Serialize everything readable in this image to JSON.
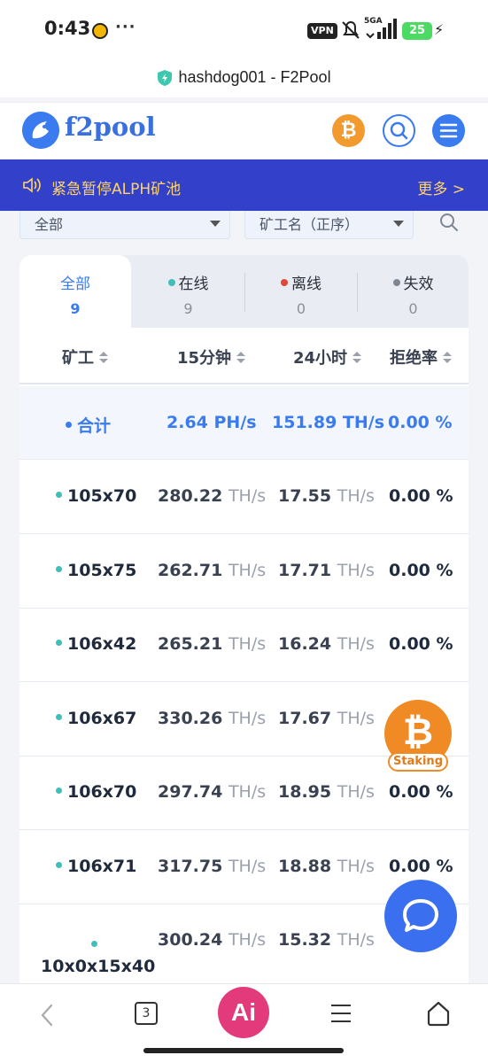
{
  "status_bar": {
    "time": "0:43",
    "dots": "···",
    "vpn": "VPN",
    "network": "5GA",
    "battery": "25"
  },
  "browser": {
    "page_title": "hashdog001 - F2Pool",
    "tab_count": "3",
    "ai_label": "Ai"
  },
  "site": {
    "logo_text": "f2pool",
    "btc_symbol": "₿"
  },
  "announcement": {
    "text": "紧急暂停ALPH矿池",
    "more": "更多 >"
  },
  "filters": {
    "status": "全部",
    "sort": "矿工名（正序）"
  },
  "tabs": [
    {
      "label": "全部",
      "count": "9"
    },
    {
      "label": "在线",
      "count": "9",
      "dot_color": "#3fbfb8"
    },
    {
      "label": "离线",
      "count": "0",
      "dot_color": "#e0473a"
    },
    {
      "label": "失效",
      "count": "0",
      "dot_color": "#7d8794"
    }
  ],
  "table": {
    "headers": [
      "矿工",
      "15分钟",
      "24小时",
      "拒绝率"
    ],
    "total": {
      "name": "合计",
      "h15": "2.64 PH/s",
      "h24": "151.89 TH/s",
      "reject": "0.00 %"
    },
    "unit": "TH/s",
    "rows": [
      {
        "name": "105x70",
        "h15": "280.22",
        "h24": "17.55",
        "reject": "0.00 %"
      },
      {
        "name": "105x75",
        "h15": "262.71",
        "h24": "17.71",
        "reject": "0.00 %"
      },
      {
        "name": "106x42",
        "h15": "265.21",
        "h24": "16.24",
        "reject": "0.00 %"
      },
      {
        "name": "106x67",
        "h15": "330.26",
        "h24": "17.67",
        "reject": ""
      },
      {
        "name": "106x70",
        "h15": "297.74",
        "h24": "18.95",
        "reject": "0.00 %"
      },
      {
        "name": "106x71",
        "h15": "317.75",
        "h24": "18.88",
        "reject": "0.00 %"
      },
      {
        "name": "10x0x15x40",
        "h15": "300.24",
        "h24": "15.32",
        "reject": ""
      }
    ]
  },
  "staking": {
    "symbol": "₿",
    "label": "Staking"
  },
  "colors": {
    "accent": "#3a7bf0",
    "announcement_bg": "#3340c9",
    "announcement_text": "#ffd36b",
    "online": "#3fbfb8",
    "btc": "#f29a2e"
  }
}
